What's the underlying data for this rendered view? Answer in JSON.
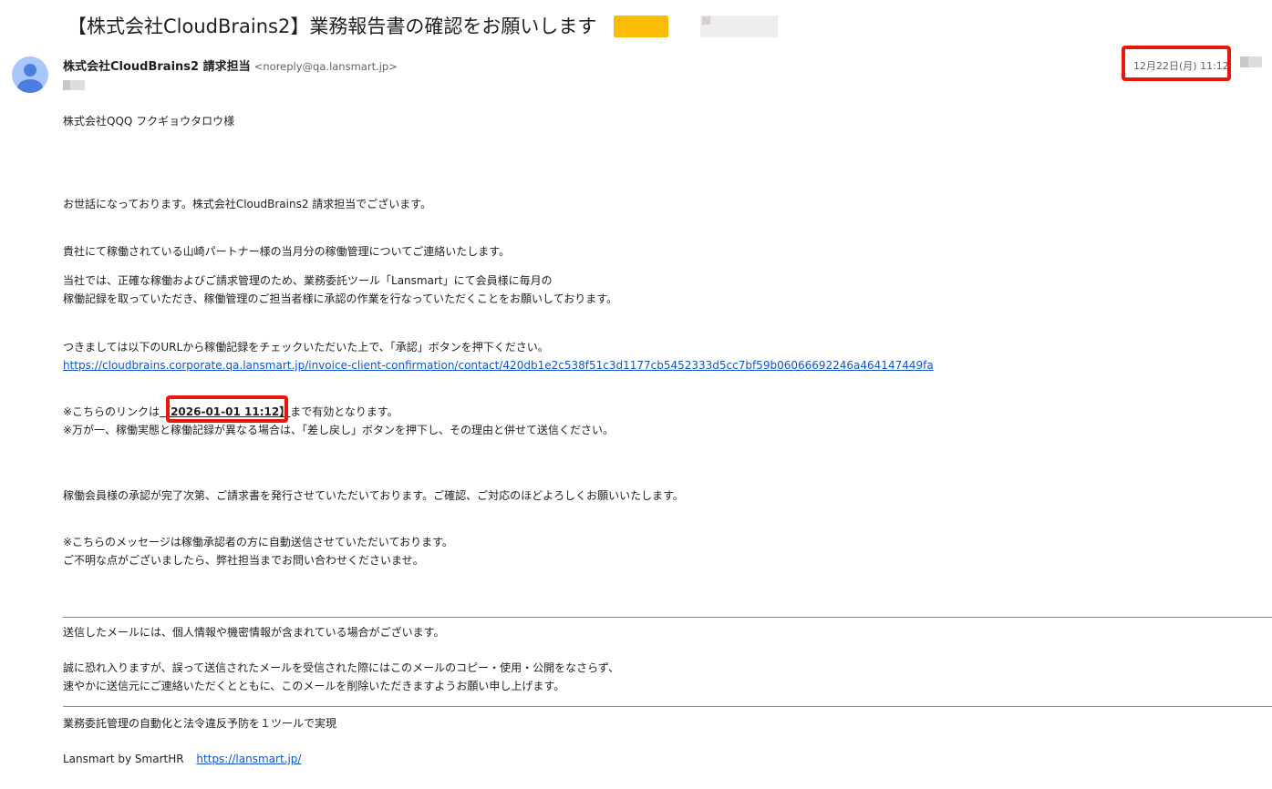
{
  "email": {
    "subject": "【株式会社CloudBrains2】業務報告書の確認をお願いします",
    "sender_name": "株式会社CloudBrains2 請求担当",
    "sender_email": "<noreply@qa.lansmart.jp>",
    "date": "12月22日(月) 11:12",
    "body": {
      "greeting": "株式会社QQQ フクギョウタロウ様",
      "intro": "お世話になっております。株式会社CloudBrains2 請求担当でございます。",
      "p1": "貴社にて稼働されている山崎パートナー様の当月分の稼働管理についてご連絡いたします。",
      "p2_line1": "当社では、正確な稼働およびご請求管理のため、業務委託ツール「Lansmart」にて会員様に毎月の",
      "p2_line2": "稼働記録を取っていただき、稼働管理のご担当者様に承認の作業を行なっていただくことをお願いしております。",
      "p3": "つきましては以下のURLから稼働記録をチェックいただいた上で、「承認」ボタンを押下ください。",
      "link": "https://cloudbrains.corporate.qa.lansmart.jp/invoice-client-confirmation/contact/420db1e2c538f51c3d1177cb5452333d5cc7bf59b06066692246a464147449fa",
      "note1_prefix": "※こちらのリンクは",
      "note1_expiry": "【2026-01-01 11:12】",
      "note1_suffix": "まで有効となります。",
      "note2": "※万が一、稼働実態と稼働記録が異なる場合は、「差し戻し」ボタンを押下し、その理由と併せて送信ください。",
      "p4": "稼働会員様の承認が完了次第、ご請求書を発行させていただいております。ご確認、ご対応のほどよろしくお願いいたします。",
      "p5_line1": "※こちらのメッセージは稼働承認者の方に自動送信させていただいております。",
      "p5_line2": "ご不明な点がございましたら、弊社担当までお問い合わせくださいませ。",
      "disclaimer1": "送信したメールには、個人情報や機密情報が含まれている場合がございます。",
      "disclaimer2_line1": "誠に恐れ入りますが、誤って送信されたメールを受信された際にはこのメールのコピー・使用・公開をなさらず、",
      "disclaimer2_line2": "速やかに送信元にご連絡いただくとともに、このメールを削除いただきますようお願い申し上げます。",
      "tagline": "業務委託管理の自動化と法令違反予防を１ツールで実現",
      "brand": "Lansmart by SmartHR",
      "brand_link": "https://lansmart.jp/"
    }
  },
  "colors": {
    "label_yellow": "#fbbc04",
    "highlight_red": "#e8170c",
    "link_blue": "#1155cc"
  }
}
